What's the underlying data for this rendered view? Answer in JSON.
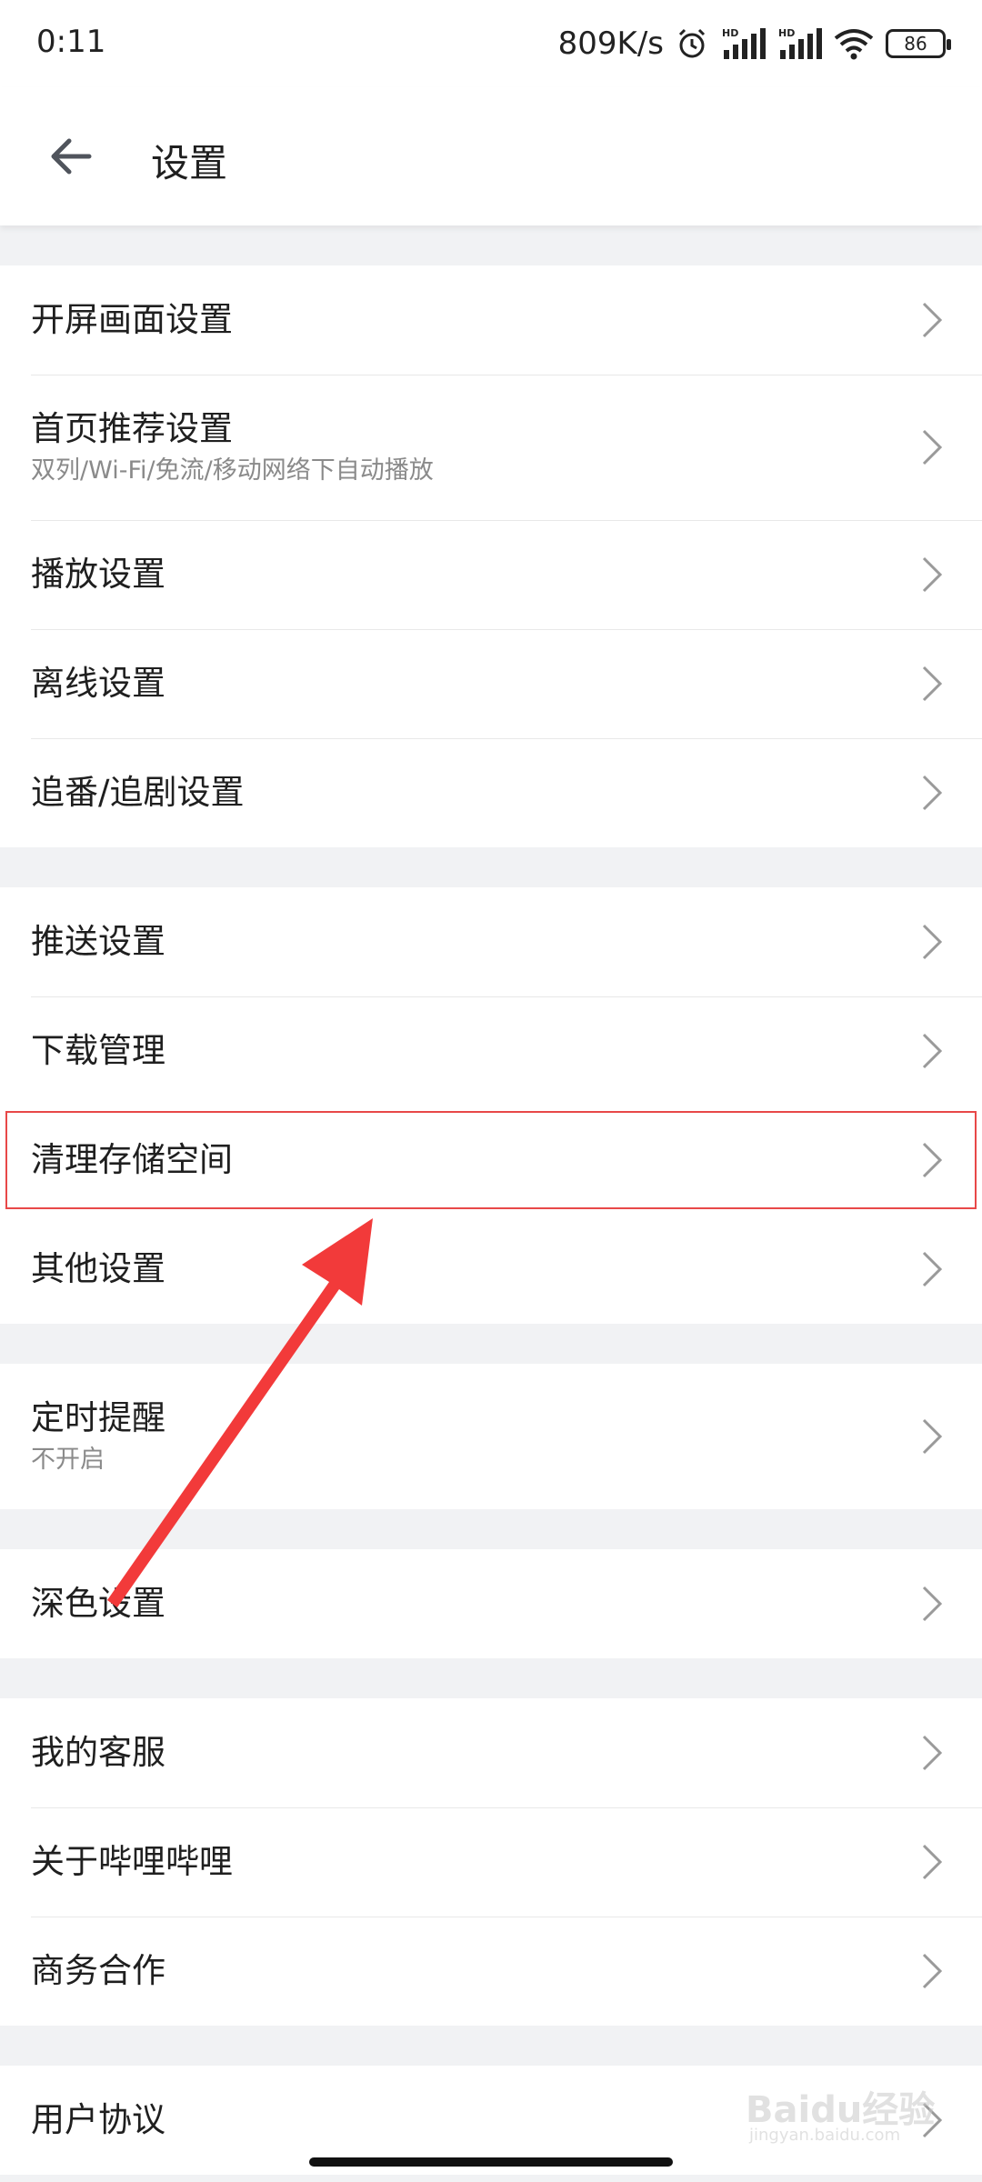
{
  "status_bar": {
    "time": "0:11",
    "speed": "809K/s",
    "battery": "86",
    "icons": [
      "alarm-icon",
      "signal-hd-icon",
      "signal-hd-icon",
      "wifi-icon",
      "battery-icon"
    ]
  },
  "header": {
    "title": "设置",
    "back_icon": "arrow-left-icon"
  },
  "groups": [
    {
      "items": [
        {
          "label": "开屏画面设置"
        },
        {
          "label": "首页推荐设置",
          "sub": "双列/Wi-Fi/免流/移动网络下自动播放"
        },
        {
          "label": "播放设置"
        },
        {
          "label": "离线设置"
        },
        {
          "label": "追番/追剧设置"
        }
      ]
    },
    {
      "items": [
        {
          "label": "推送设置"
        },
        {
          "label": "下载管理"
        },
        {
          "label": "清理存储空间"
        },
        {
          "label": "其他设置"
        }
      ]
    },
    {
      "items": [
        {
          "label": "定时提醒",
          "sub": "不开启"
        }
      ]
    },
    {
      "items": [
        {
          "label": "深色设置"
        }
      ]
    },
    {
      "items": [
        {
          "label": "我的客服"
        },
        {
          "label": "关于哔哩哔哩"
        },
        {
          "label": "商务合作"
        }
      ]
    },
    {
      "items": [
        {
          "label": "用户协议"
        }
      ]
    }
  ],
  "watermark": {
    "text": "Baidu经验",
    "sub": "jingyan.baidu.com"
  },
  "colors": {
    "annotation": "#e84848",
    "background": "#f1f2f4"
  }
}
